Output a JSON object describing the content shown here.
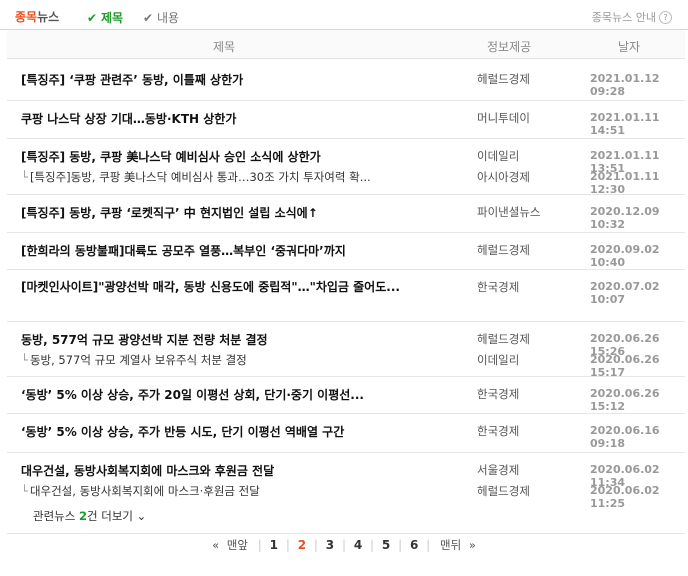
{
  "tabs": {
    "brand": "종목",
    "rest": "뉴스",
    "opt_title": "제목",
    "opt_content": "내용",
    "guide": "종목뉴스 안내"
  },
  "header": {
    "col_title": "제목",
    "col_source": "정보제공",
    "col_date": "날자"
  },
  "rows": [
    {
      "title": "[특징주] ‘쿠팡 관련주’ 동방, 이틀째 상한가",
      "source": "헤럴드경제",
      "date": "2021.01.12 09:28"
    },
    {
      "title": "쿠팡 나스닥 상장 기대…동방·KTH 상한가",
      "source": "머니투데이",
      "date": "2021.01.11 14:51"
    },
    {
      "title": "[특징주] 동방, 쿠팡 美나스닥 예비심사 승인 소식에 상한가",
      "source": "이데일리",
      "date": "2021.01.11 13:51",
      "sub": {
        "title": "[특징주]동방, 쿠팡 美나스닥 예비심사 통과…30조 가치 투자여력 확...",
        "source": "아시아경제",
        "date": "2021.01.11 12:30"
      }
    },
    {
      "title": "[특징주] 동방, 쿠팡 ‘로켓직구’ 中 현지법인 설립 소식에↑",
      "source": "파이낸셜뉴스",
      "date": "2020.12.09 10:32"
    },
    {
      "title": "[한희라의 동방불패]대륙도 공모주 열풍…복부인 ‘중궈다마’까지",
      "source": "헤럴드경제",
      "date": "2020.09.02 10:40"
    },
    {
      "title": "[마켓인사이트]\"광양선박 매각, 동방 신용도에 중립적\"…\"차입금 줄어도...",
      "source": "한국경제",
      "date": "2020.07.02 10:07"
    },
    {
      "title": "동방, 577억 규모 광양선박 지분 전량 처분 결정",
      "source": "헤럴드경제",
      "date": "2020.06.26 15:26",
      "sub": {
        "title": "동방, 577억 규모 계열사 보유주식 처분 결정",
        "source": "이데일리",
        "date": "2020.06.26 15:17"
      }
    },
    {
      "title": "‘동방’ 5% 이상 상승, 주가 20일 이평선 상회, 단기·중기 이평선...",
      "source": "한국경제",
      "date": "2020.06.26 15:12"
    },
    {
      "title": "‘동방’ 5% 이상 상승, 주가 반등 시도, 단기 이평선 역배열 구간",
      "source": "한국경제",
      "date": "2020.06.16 09:18"
    },
    {
      "title": "대우건설, 동방사회복지회에 마스크와 후원금 전달",
      "source": "서울경제",
      "date": "2020.06.02 11:34",
      "sub": {
        "title": "대우건설, 동방사회복지회에 마스크·후원금 전달",
        "source": "헤럴드경제",
        "date": "2020.06.02 11:25"
      },
      "related": {
        "prefix": "관련뉴스 ",
        "count": "2",
        "suffix": "건 더보기"
      }
    }
  ],
  "pager": {
    "first": "맨앞",
    "pages": [
      "1",
      "2",
      "3",
      "4",
      "5",
      "6"
    ],
    "current": "2",
    "last": "맨뒤"
  }
}
